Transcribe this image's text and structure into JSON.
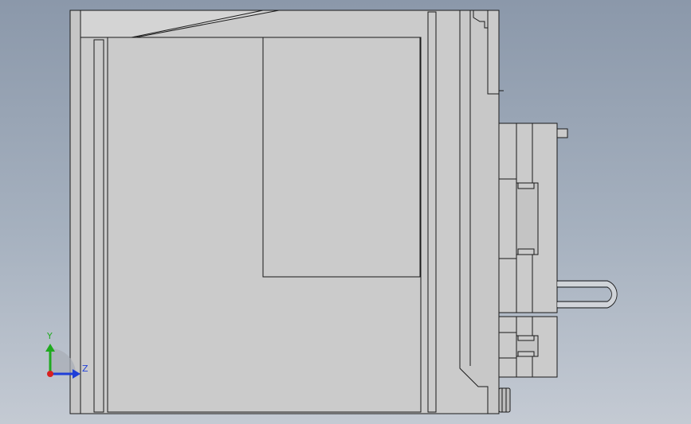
{
  "view": {
    "background_top": "#8b98aa",
    "background_bottom": "#c4cad3",
    "part_fill": "#cbcbcb",
    "edge_color": "#1a1a1a"
  },
  "triad": {
    "y_label": "Y",
    "z_label": "Z",
    "y_color": "#1faa1f",
    "z_color": "#1f3fd8",
    "origin_color": "#d82020"
  }
}
